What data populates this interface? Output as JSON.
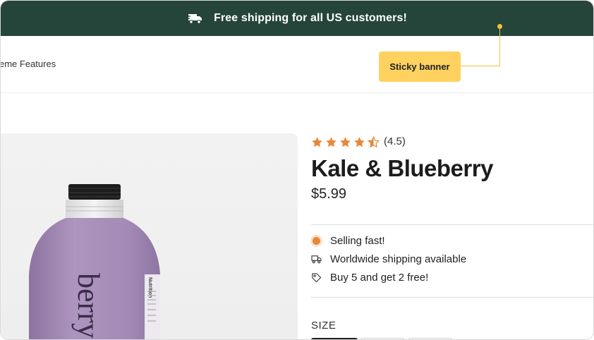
{
  "banner": {
    "text": "Free shipping for all US customers!",
    "icon": "truck-icon"
  },
  "nav": {
    "link": "eme Features"
  },
  "annotation": {
    "label": "Sticky banner",
    "color": "#ffd260"
  },
  "product": {
    "rating": 4.5,
    "rating_text": "(4.5)",
    "title": "Kale & Blueberry",
    "price": "$5.99",
    "bottle_text": "berry",
    "label_text": "Nutrition",
    "features": [
      {
        "icon": "selling-fast-dot-icon",
        "text": "Selling fast!"
      },
      {
        "icon": "truck-icon",
        "text": "Worldwide shipping available"
      },
      {
        "icon": "tag-icon",
        "text": "Buy 5 and get 2 free!"
      }
    ],
    "size_label": "SIZE"
  },
  "colors": {
    "banner_bg": "#25443a",
    "star": "#e8883a",
    "bottle": "#a98fba"
  }
}
